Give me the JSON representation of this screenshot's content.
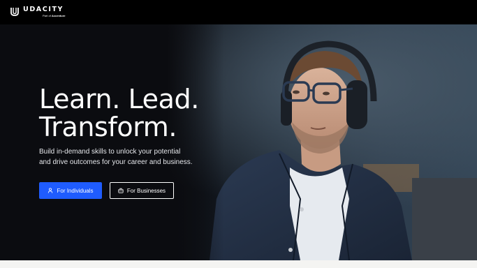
{
  "brand": {
    "name": "UDACITY",
    "tagline_prefix": "Part of",
    "tagline_company": "Accenture"
  },
  "hero": {
    "headline_line1": "Learn. Lead.",
    "headline_line2": "Transform.",
    "subtext": "Build in-demand skills to unlock your potential and drive outcomes for your career and business.",
    "primary_button": {
      "label": "For Individuals",
      "icon": "person-icon",
      "color": "#1f5cff"
    },
    "secondary_button": {
      "label": "For Businesses",
      "icon": "briefcase-icon"
    }
  }
}
